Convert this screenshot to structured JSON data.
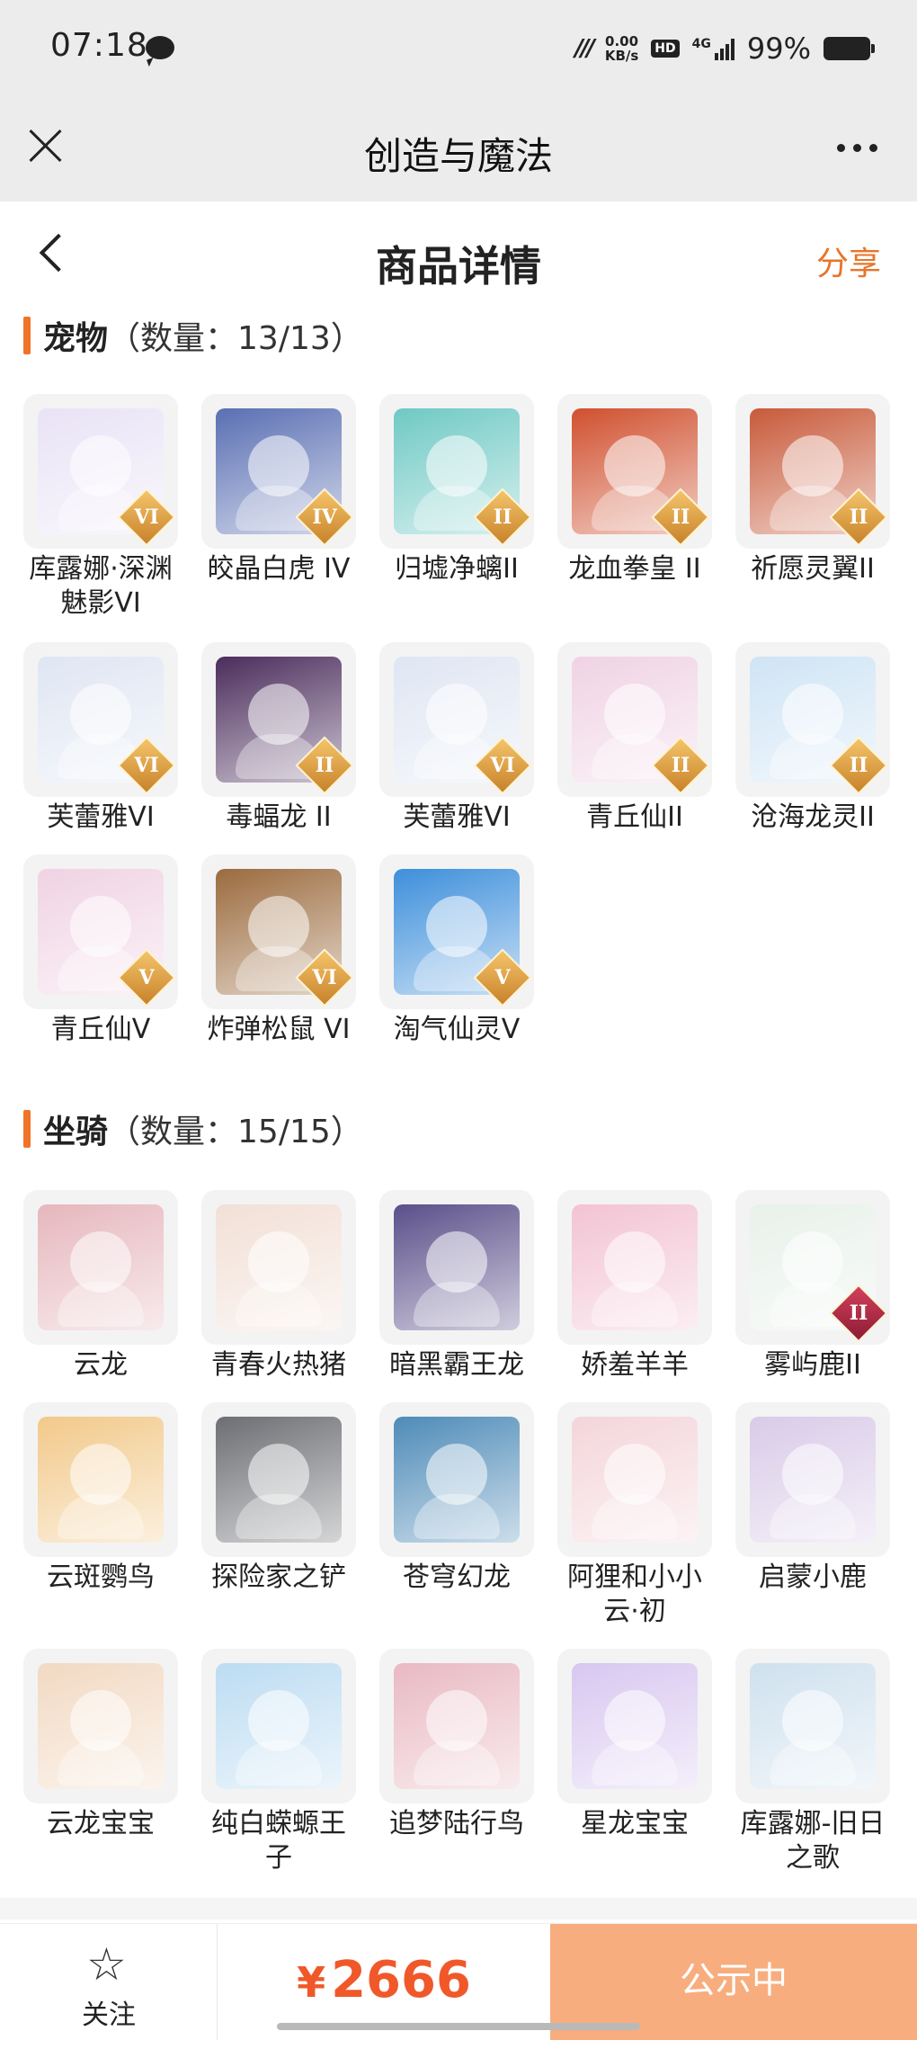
{
  "status": {
    "time": "07:18",
    "speed_value": "0.00",
    "speed_unit": "KB/s",
    "hd": "HD",
    "net": "4G",
    "battery": "99%"
  },
  "app": {
    "title": "创造与魔法"
  },
  "header": {
    "title": "商品详情",
    "share": "分享"
  },
  "pets": {
    "title": "宠物",
    "count": "（数量：13/13）",
    "items": [
      {
        "name": "库露娜·深渊魅影VI",
        "tier": "VI",
        "color": "#e9e3f6"
      },
      {
        "name": "皎晶白虎 IV",
        "tier": "IV",
        "color": "#5a6fb3"
      },
      {
        "name": "归墟净螭II",
        "tier": "II",
        "color": "#6fc9c4"
      },
      {
        "name": "龙血拳皇 II",
        "tier": "II",
        "color": "#d0502f"
      },
      {
        "name": "祈愿灵翼II",
        "tier": "II",
        "color": "#c85a3a"
      },
      {
        "name": "芙蕾雅VI",
        "tier": "VI",
        "color": "#dfe6f3"
      },
      {
        "name": "毒蝠龙 II",
        "tier": "II",
        "color": "#4b2d5c"
      },
      {
        "name": "芙蕾雅VI",
        "tier": "VI",
        "color": "#dfe6f3"
      },
      {
        "name": "青丘仙II",
        "tier": "II",
        "color": "#f0d3e4"
      },
      {
        "name": "沧海龙灵II",
        "tier": "II",
        "color": "#cfe4f5"
      },
      {
        "name": "青丘仙V",
        "tier": "V",
        "color": "#f0d3e4"
      },
      {
        "name": "炸弹松鼠 VI",
        "tier": "VI",
        "color": "#9b6b3e"
      },
      {
        "name": "淘气仙灵V",
        "tier": "V",
        "color": "#3d8fdb"
      }
    ]
  },
  "mounts": {
    "title": "坐骑",
    "count": "（数量：15/15）",
    "items": [
      {
        "name": "云龙",
        "tier": "",
        "color": "#e6b7bd"
      },
      {
        "name": "青春火热猪",
        "tier": "",
        "color": "#f2e0d6"
      },
      {
        "name": "暗黑霸王龙",
        "tier": "",
        "color": "#5b4f8a"
      },
      {
        "name": "娇羞羊羊",
        "tier": "",
        "color": "#f3c3d3"
      },
      {
        "name": "雾屿鹿II",
        "tier": "II",
        "color": "#e8f1ea"
      },
      {
        "name": "云斑鹦鸟",
        "tier": "",
        "color": "#f2c98a"
      },
      {
        "name": "探险家之铲",
        "tier": "",
        "color": "#6c6e73"
      },
      {
        "name": "苍穹幻龙",
        "tier": "",
        "color": "#4e8bb8"
      },
      {
        "name": "阿狸和小小云·初",
        "tier": "",
        "color": "#f4d5da"
      },
      {
        "name": "启蒙小鹿",
        "tier": "",
        "color": "#d9cbe8"
      },
      {
        "name": "云龙宝宝",
        "tier": "",
        "color": "#f2d9c2"
      },
      {
        "name": "纯白蝾螈王子",
        "tier": "",
        "color": "#bcdcf2"
      },
      {
        "name": "追梦陆行鸟",
        "tier": "",
        "color": "#e9b9c2"
      },
      {
        "name": "星龙宝宝",
        "tier": "",
        "color": "#d8c7f0"
      },
      {
        "name": "库露娜-旧日之歌",
        "tier": "",
        "color": "#cfe1ee"
      }
    ]
  },
  "footer": {
    "follow": "关注",
    "currency": "¥",
    "price": "2666",
    "status": "公示中"
  }
}
